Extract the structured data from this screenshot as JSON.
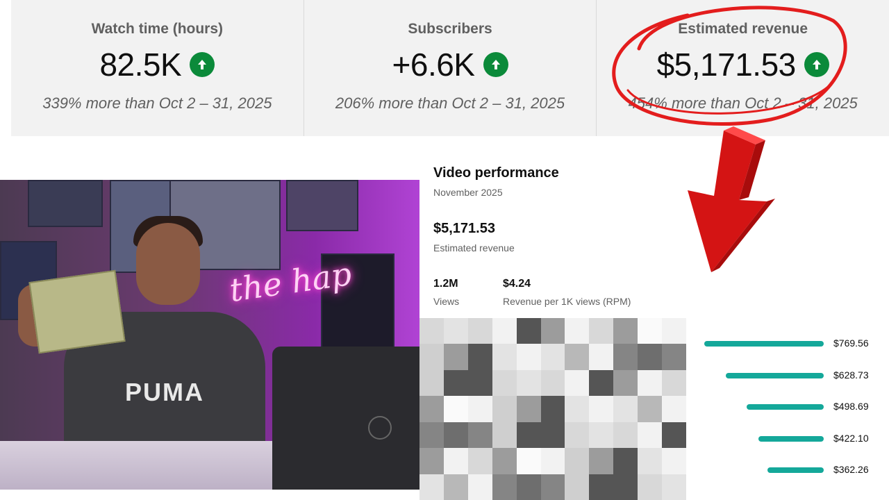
{
  "metrics": [
    {
      "label": "Watch time (hours)",
      "value": "82.5K",
      "compare": "339% more than Oct 2 – 31, 2025",
      "trend_icon": "arrow-up-icon"
    },
    {
      "label": "Subscribers",
      "value": "+6.6K",
      "compare": "206% more than Oct 2 – 31, 2025",
      "trend_icon": "arrow-up-icon"
    },
    {
      "label": "Estimated revenue",
      "value": "$5,171.53",
      "compare": "454% more than Oct 2 – 31, 2025",
      "trend_icon": "arrow-up-icon"
    }
  ],
  "video": {
    "neon_text": "the hap",
    "shirt_text": "PUMA"
  },
  "video_performance": {
    "title": "Video performance",
    "period": "November 2025",
    "revenue": "$5,171.53",
    "revenue_label": "Estimated revenue",
    "views": "1.2M",
    "views_label": "Views",
    "rpm": "$4.24",
    "rpm_label": "Revenue per 1K views (RPM)",
    "top_videos_revenue": [
      {
        "value": 769.56,
        "label": "$769.56"
      },
      {
        "value": 628.73,
        "label": "$628.73"
      },
      {
        "value": 498.69,
        "label": "$498.69"
      },
      {
        "value": 422.1,
        "label": "$422.10"
      },
      {
        "value": 362.26,
        "label": "$362.26"
      }
    ]
  },
  "colors": {
    "trend_up": "#0b8a3a",
    "bar": "#14a89a",
    "annotation": "#e31d1d"
  }
}
